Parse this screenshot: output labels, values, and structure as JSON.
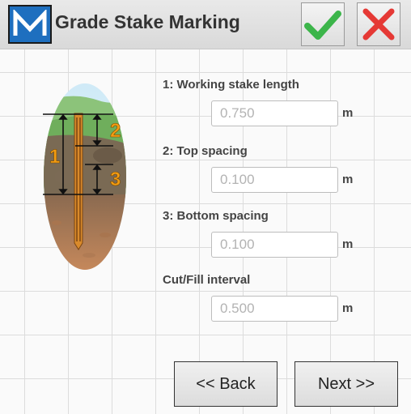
{
  "header": {
    "logo_letter": "M",
    "title": "Grade Stake Marking",
    "ok_icon": "check-icon",
    "cancel_icon": "x-icon"
  },
  "diagram": {
    "labels": [
      "1",
      "2",
      "3"
    ]
  },
  "fields": [
    {
      "label": "1: Working stake length",
      "value": "0.750",
      "unit": "m"
    },
    {
      "label": "2: Top spacing",
      "value": "0.100",
      "unit": "m"
    },
    {
      "label": "3: Bottom spacing",
      "value": "0.100",
      "unit": "m"
    },
    {
      "label": "Cut/Fill interval",
      "value": "0.500",
      "unit": "m"
    }
  ],
  "buttons": {
    "back": "<< Back",
    "next": "Next >>"
  },
  "colors": {
    "ok": "#3cb54a",
    "cancel": "#e53935",
    "logo": "#1e6fbf",
    "label_accent": "#f39c12"
  }
}
